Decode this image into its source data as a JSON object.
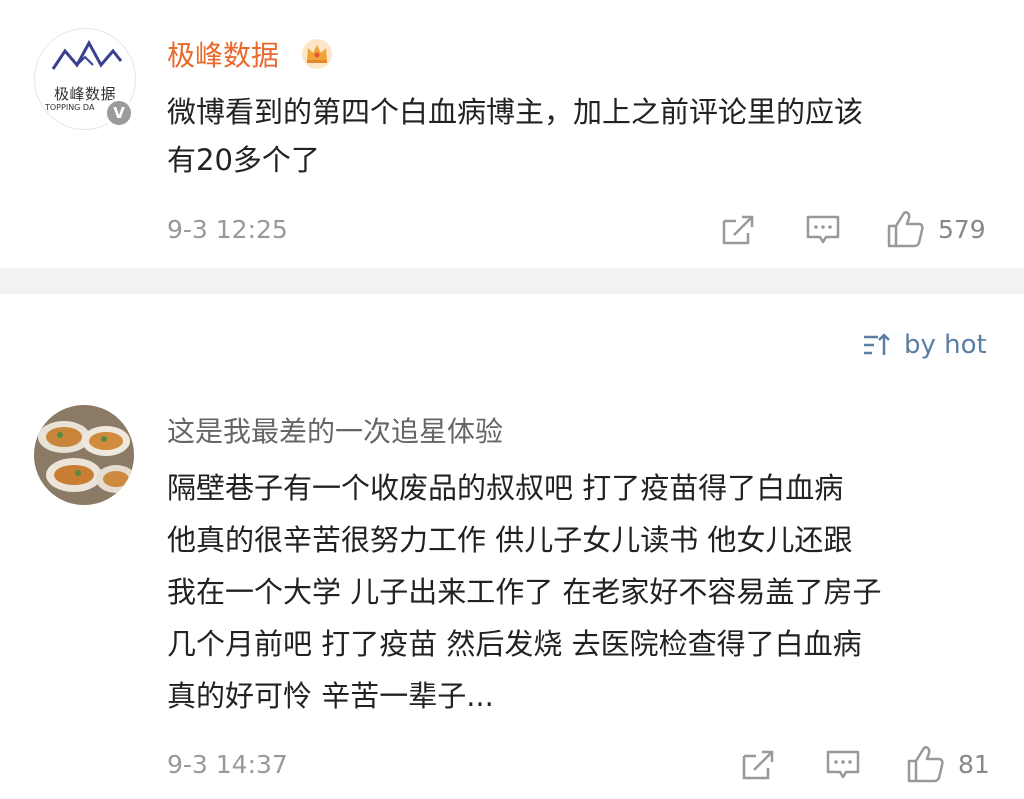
{
  "post": {
    "author": "极峰数据",
    "avatar_logo_text": "极峰数据",
    "avatar_logo_sub": "TOPPING DA",
    "verified_badge": "V",
    "text_line1": "微博看到的第四个白血病博主，加上之前评论里的应该",
    "text_line2": "有20多个了",
    "timestamp": "9-3 12:25",
    "like_count": "579"
  },
  "sort": {
    "label": "by hot"
  },
  "comment": {
    "author": "这是我最差的一次追星体验",
    "lines": [
      "隔壁巷子有一个收废品的叔叔吧 打了疫苗得了白血病",
      "他真的很辛苦很努力工作 供儿子女儿读书 他女儿还跟",
      "我在一个大学 儿子出来工作了 在老家好不容易盖了房子",
      "几个月前吧 打了疫苗 然后发烧 去医院检查得了白血病",
      "真的好可怜 辛苦一辈子..."
    ],
    "timestamp": "9-3 14:37",
    "like_count": "81"
  },
  "colors": {
    "username": "#e8692b",
    "link": "#5b7fa3",
    "meta": "#999999",
    "separator": "#f2f2f2"
  },
  "icons": [
    "crown-icon",
    "verified-icon",
    "share-icon",
    "comment-icon",
    "like-icon",
    "sort-icon"
  ]
}
